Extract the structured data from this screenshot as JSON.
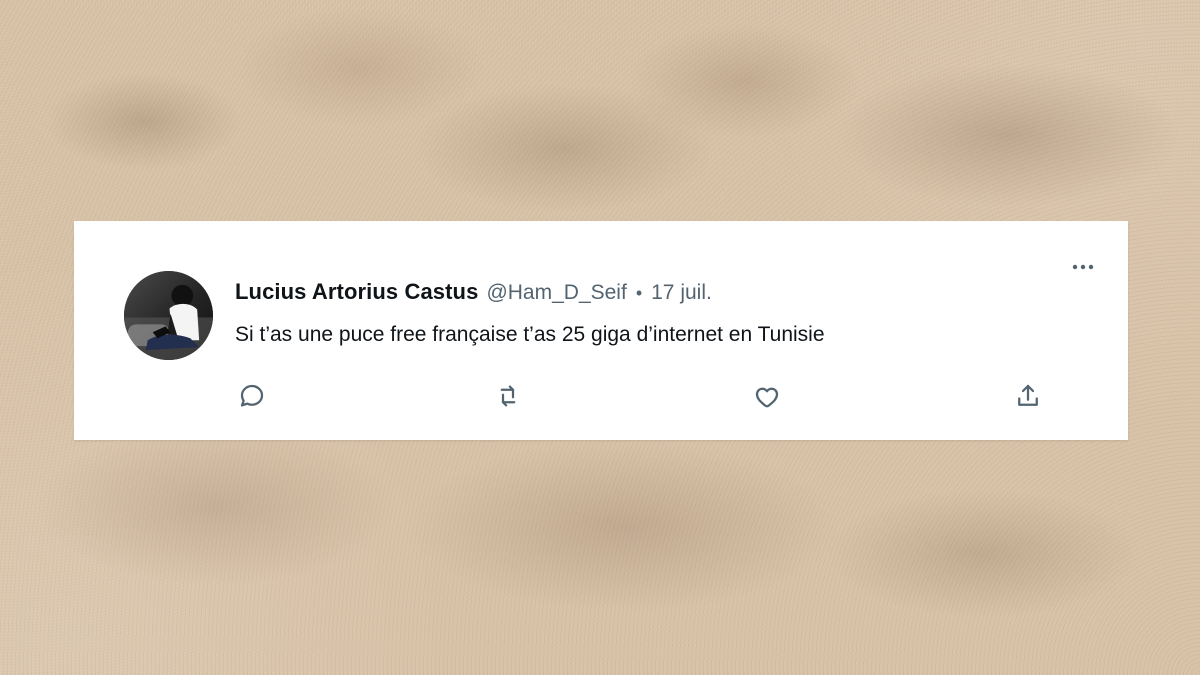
{
  "tweet": {
    "author_name": "Lucius Artorius Castus",
    "author_handle": "@Ham_D_Seif",
    "separator": "•",
    "date": "17 juil.",
    "text": "Si t’as une puce free française t’as 25 giga d’internet en Tunisie"
  },
  "icons": {
    "more": "more-icon",
    "reply": "reply-icon",
    "retweet": "retweet-icon",
    "like": "like-icon",
    "share": "share-icon"
  },
  "colors": {
    "card_background": "#ffffff",
    "text_primary": "#0f1419",
    "text_secondary": "#536471",
    "background_sand": "#d8c2a7"
  }
}
